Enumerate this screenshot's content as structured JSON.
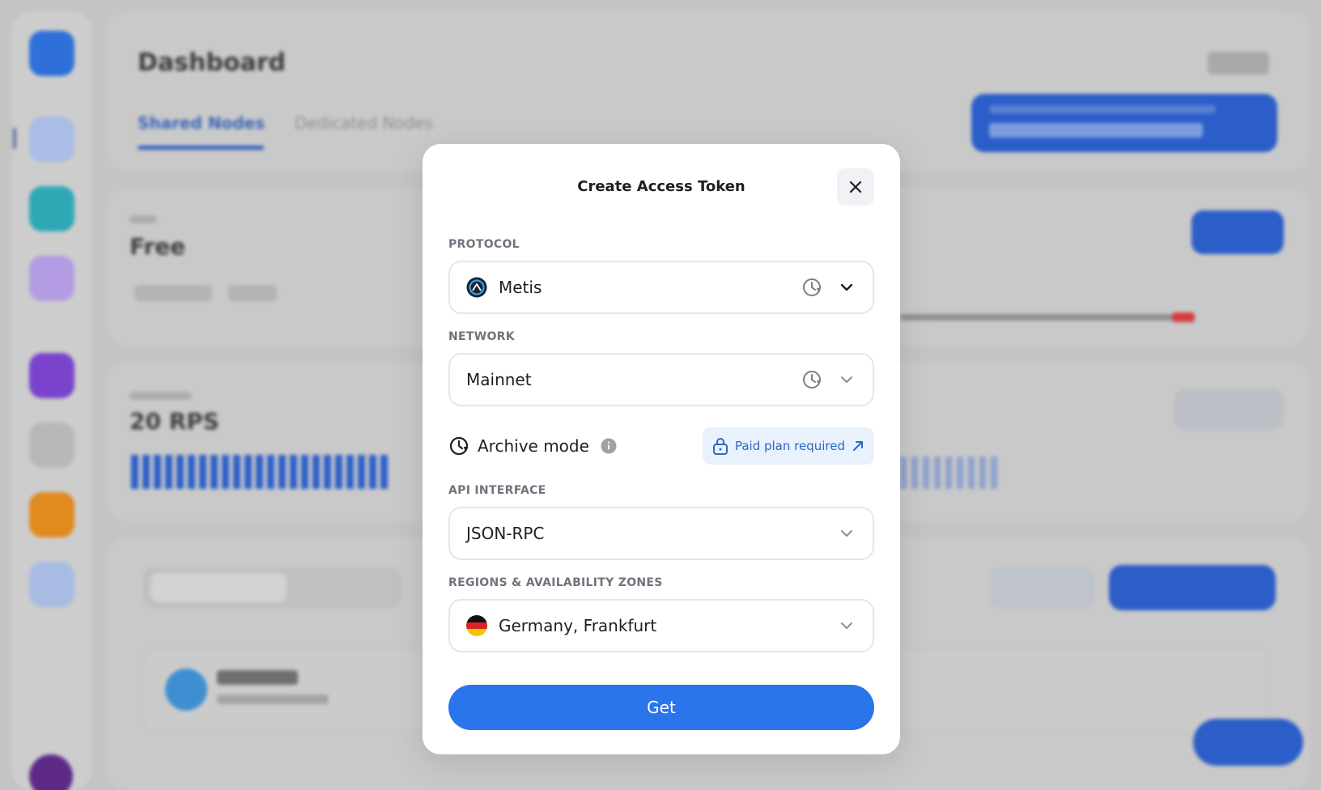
{
  "background": {
    "dashboard_title": "Dashboard",
    "tabs": [
      {
        "label": "Shared Nodes",
        "active": true
      },
      {
        "label": "Dedicated Nodes",
        "active": false
      }
    ],
    "plan_name": "Free",
    "rps_value": "20 RPS"
  },
  "modal": {
    "title": "Create Access Token",
    "protocol": {
      "label": "PROTOCOL",
      "value": "Metis",
      "icon": "metis-logo-icon"
    },
    "network": {
      "label": "NETWORK",
      "value": "Mainnet"
    },
    "archive": {
      "label": "Archive mode",
      "badge": "Paid plan required"
    },
    "api_interface": {
      "label": "API INTERFACE",
      "value": "JSON-RPC"
    },
    "region": {
      "label": "REGIONS & AVAILABILITY ZONES",
      "value": "Germany, Frankfurt",
      "icon": "germany-flag-icon"
    },
    "submit_label": "Get"
  },
  "colors": {
    "primary": "#2a74ec",
    "badge_bg": "#e9f1fc",
    "badge_text": "#2b68c2",
    "field_border": "#e4e7ec"
  }
}
